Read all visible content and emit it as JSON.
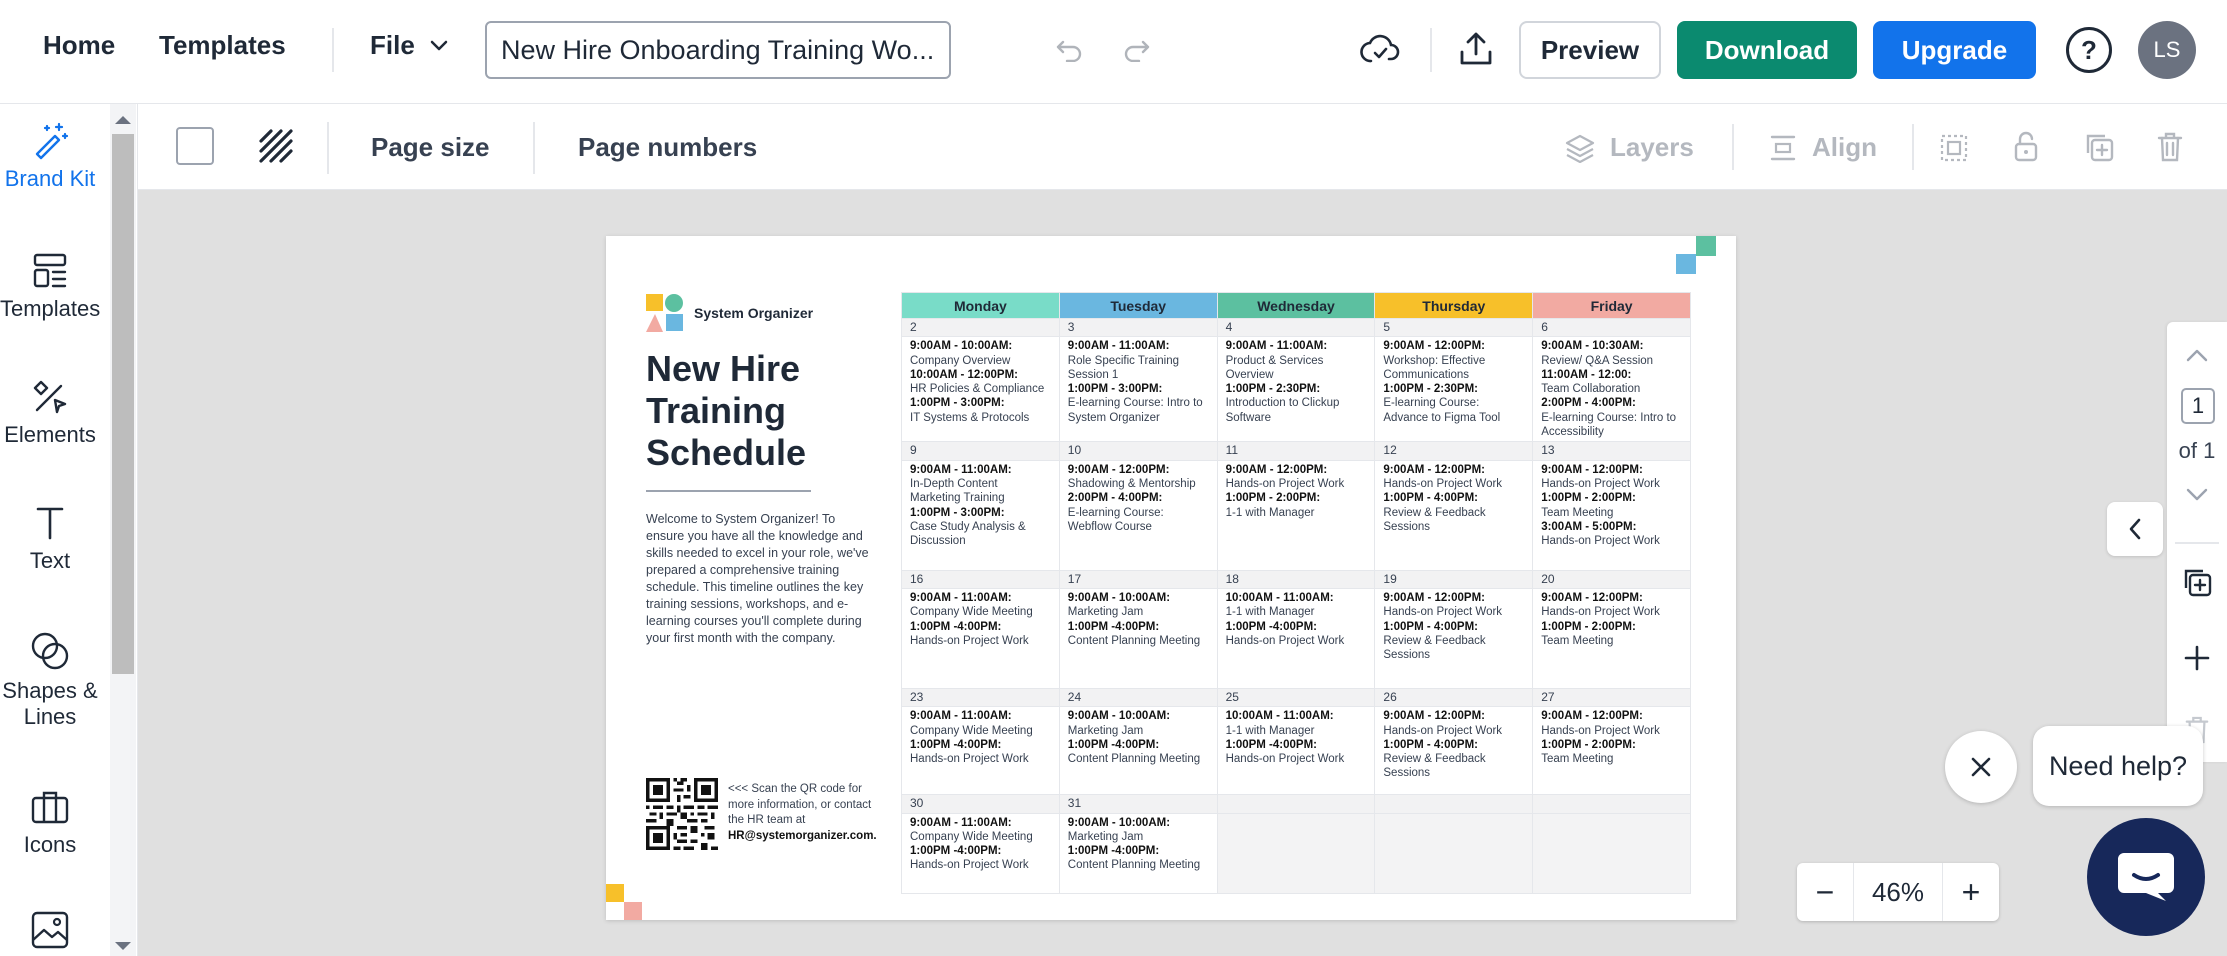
{
  "topbar": {
    "home": "Home",
    "templates": "Templates",
    "file": "File",
    "doc_title": "New Hire Onboarding Training Wo...",
    "preview": "Preview",
    "download": "Download",
    "upgrade": "Upgrade",
    "help": "?",
    "avatar": "LS"
  },
  "sidebar": {
    "items": [
      {
        "label": "Brand Kit",
        "icon": "magic-wand-icon"
      },
      {
        "label": "Templates",
        "icon": "templates-icon"
      },
      {
        "label": "Elements",
        "icon": "elements-icon"
      },
      {
        "label": "Text",
        "icon": "text-icon"
      },
      {
        "label": "Shapes & Lines",
        "icon": "shapes-icon"
      },
      {
        "label": "Icons",
        "icon": "briefcase-icon"
      },
      {
        "label": "",
        "icon": "image-icon"
      }
    ]
  },
  "toolbar": {
    "page_size": "Page size",
    "page_numbers": "Page numbers",
    "layers": "Layers",
    "align": "Align"
  },
  "document": {
    "logo_text": "System Organizer",
    "title": "New Hire Training Schedule",
    "intro": "Welcome to System Organizer! To ensure you have all the knowledge and skills needed to excel in your role, we've prepared a comprehensive training schedule. This timeline outlines the key training sessions, workshops, and e-learning courses you'll complete during your first month with the company.",
    "qr_text": "<<< Scan the QR code for more information, or contact the HR team at",
    "qr_email": "HR@systemorganizer.com.",
    "colors": {
      "monday": "#79dcc8",
      "tuesday": "#6ab7e0",
      "wednesday": "#5cc0a0",
      "thursday": "#f7c02a",
      "friday": "#f2aaa2"
    },
    "days": [
      "Monday",
      "Tuesday",
      "Wednesday",
      "Thursday",
      "Friday"
    ],
    "weeks": [
      {
        "dates": [
          "2",
          "3",
          "4",
          "5",
          "6"
        ],
        "cells": [
          [
            [
              "9:00AM - 10:00AM:",
              "Company Overview"
            ],
            [
              "10:00AM - 12:00PM:",
              "HR Policies & Compliance"
            ],
            [
              "1:00PM - 3:00PM:",
              "IT Systems & Protocols"
            ]
          ],
          [
            [
              "9:00AM - 11:00AM:",
              "Role Specific Training Session 1"
            ],
            [
              "1:00PM - 3:00PM:",
              "E-learning Course: Intro to System Organizer"
            ]
          ],
          [
            [
              "9:00AM - 11:00AM:",
              "Product & Services Overview"
            ],
            [
              "1:00PM - 2:30PM:",
              "Introduction to Clickup Software"
            ]
          ],
          [
            [
              "9:00AM - 12:00PM:",
              "Workshop: Effective Communications"
            ],
            [
              "1:00PM - 2:30PM:",
              "E-learning Course: Advance to Figma Tool"
            ]
          ],
          [
            [
              "9:00AM - 10:30AM:",
              "Review/ Q&A Session"
            ],
            [
              "11:00AM - 12:00:",
              "Team Collaboration"
            ],
            [
              "2:00PM - 4:00PM:",
              "E-learning Course: Intro to Accessibility"
            ]
          ]
        ]
      },
      {
        "dates": [
          "9",
          "10",
          "11",
          "12",
          "13"
        ],
        "cells": [
          [
            [
              "9:00AM - 11:00AM:",
              "In-Depth Content Marketing Training"
            ],
            [
              "1:00PM - 3:00PM:",
              "Case Study Analysis & Discussion"
            ]
          ],
          [
            [
              "9:00AM - 12:00PM:",
              "Shadowing & Mentorship"
            ],
            [
              "2:00PM - 4:00PM:",
              "E-learning Course: Webflow Course"
            ]
          ],
          [
            [
              "9:00AM - 12:00PM:",
              "Hands-on Project Work"
            ],
            [
              "1:00PM - 2:00PM:",
              "1-1 with Manager"
            ]
          ],
          [
            [
              "9:00AM - 12:00PM:",
              "Hands-on Project Work"
            ],
            [
              "1:00PM - 4:00PM:",
              "Review & Feedback Sessions"
            ]
          ],
          [
            [
              "9:00AM - 12:00PM:",
              "Hands-on Project Work"
            ],
            [
              "1:00PM - 2:00PM:",
              "Team Meeting"
            ],
            [
              "3:00AM - 5:00PM:",
              "Hands-on Project Work"
            ]
          ]
        ]
      },
      {
        "dates": [
          "16",
          "17",
          "18",
          "19",
          "20"
        ],
        "cells": [
          [
            [
              "9:00AM - 11:00AM:",
              "Company Wide Meeting"
            ],
            [
              "1:00PM -4:00PM:",
              "Hands-on Project Work"
            ]
          ],
          [
            [
              "9:00AM - 10:00AM:",
              "Marketing Jam"
            ],
            [
              "1:00PM -4:00PM:",
              "Content Planning Meeting"
            ]
          ],
          [
            [
              "10:00AM - 11:00AM:",
              "1-1 with Manager"
            ],
            [
              "1:00PM -4:00PM:",
              "Hands-on Project Work"
            ]
          ],
          [
            [
              "9:00AM - 12:00PM:",
              "Hands-on Project Work"
            ],
            [
              "1:00PM - 4:00PM:",
              "Review & Feedback Sessions"
            ]
          ],
          [
            [
              "9:00AM - 12:00PM:",
              "Hands-on Project Work"
            ],
            [
              "1:00PM - 2:00PM:",
              "Team Meeting"
            ]
          ]
        ]
      },
      {
        "dates": [
          "23",
          "24",
          "25",
          "26",
          "27"
        ],
        "cells": [
          [
            [
              "9:00AM - 11:00AM:",
              "Company Wide Meeting"
            ],
            [
              "1:00PM -4:00PM:",
              "Hands-on Project Work"
            ]
          ],
          [
            [
              "9:00AM - 10:00AM:",
              "Marketing Jam"
            ],
            [
              "1:00PM -4:00PM:",
              "Content Planning Meeting"
            ]
          ],
          [
            [
              "10:00AM - 11:00AM:",
              "1-1 with Manager"
            ],
            [
              "1:00PM -4:00PM:",
              "Hands-on Project Work"
            ]
          ],
          [
            [
              "9:00AM - 12:00PM:",
              "Hands-on Project Work"
            ],
            [
              "1:00PM - 4:00PM:",
              "Review & Feedback Sessions"
            ]
          ],
          [
            [
              "9:00AM - 12:00PM:",
              "Hands-on Project Work"
            ],
            [
              "1:00PM - 2:00PM:",
              "Team Meeting"
            ]
          ]
        ]
      },
      {
        "dates": [
          "30",
          "31",
          "",
          "",
          ""
        ],
        "cells": [
          [
            [
              "9:00AM - 11:00AM:",
              "Company Wide Meeting"
            ],
            [
              "1:00PM -4:00PM:",
              "Hands-on Project Work"
            ]
          ],
          [
            [
              "9:00AM - 10:00AM:",
              "Marketing Jam"
            ],
            [
              "1:00PM -4:00PM:",
              "Content Planning Meeting"
            ]
          ],
          [],
          [],
          []
        ]
      }
    ]
  },
  "pager": {
    "current": "1",
    "of": "of 1"
  },
  "zoom": {
    "minus": "−",
    "value": "46%",
    "plus": "+"
  },
  "help": {
    "bubble": "Need help?"
  }
}
